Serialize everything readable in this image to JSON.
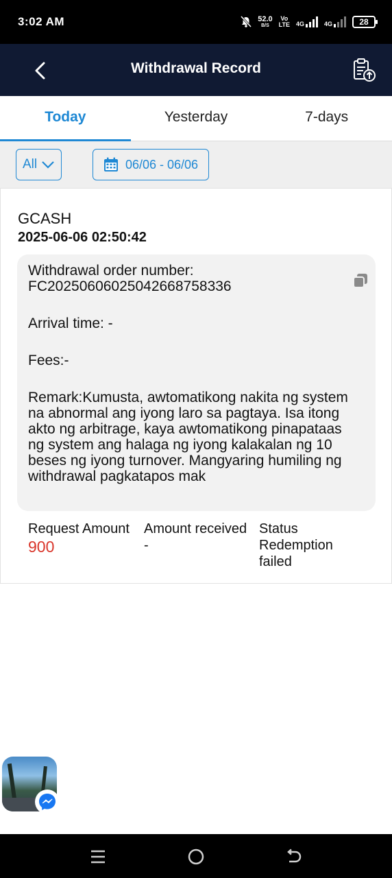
{
  "status_bar": {
    "time": "3:02 AM",
    "net_speed_value": "52.0",
    "net_speed_unit": "B/S",
    "volte_top": "Vo",
    "volte_bottom": "LTE",
    "signal1_label": "4G",
    "signal2_label": "4G",
    "battery": "28"
  },
  "header": {
    "title": "Withdrawal Record",
    "back_icon": "chevron-left-icon",
    "action_icon": "clipboard-upload-icon"
  },
  "tabs": [
    {
      "label": "Today",
      "active": true
    },
    {
      "label": "Yesterday",
      "active": false
    },
    {
      "label": "7-days",
      "active": false
    }
  ],
  "filters": {
    "type_value": "All",
    "date_range": "06/06 - 06/06"
  },
  "record": {
    "method": "GCASH",
    "datetime": "2025-06-06 02:50:42",
    "order_number_label": "Withdrawal order number:",
    "order_number": "FC2025060602504266875833​6",
    "arrival_time": "Arrival time: -",
    "fees": "Fees:-",
    "remark": "Remark:Kumusta, awtomatikong nakita ng system na abnormal ang iyong laro sa pagtaya. Isa itong akto ng arbitrage, kaya awtomatikong pinapataas ng system ang halaga ng iyong kalakalan ng 10 beses ng iyong turnover. Mangyaring humiling ng withdrawal pagkatapos mak",
    "request_amount_label": "Request Amount",
    "request_amount": "900",
    "amount_received_label": "Amount received",
    "amount_received": "-",
    "status_label": "Status",
    "status": "Redemption failed"
  },
  "colors": {
    "header_bg": "#101a33",
    "accent": "#1e88d4",
    "amount": "#d9362b"
  }
}
